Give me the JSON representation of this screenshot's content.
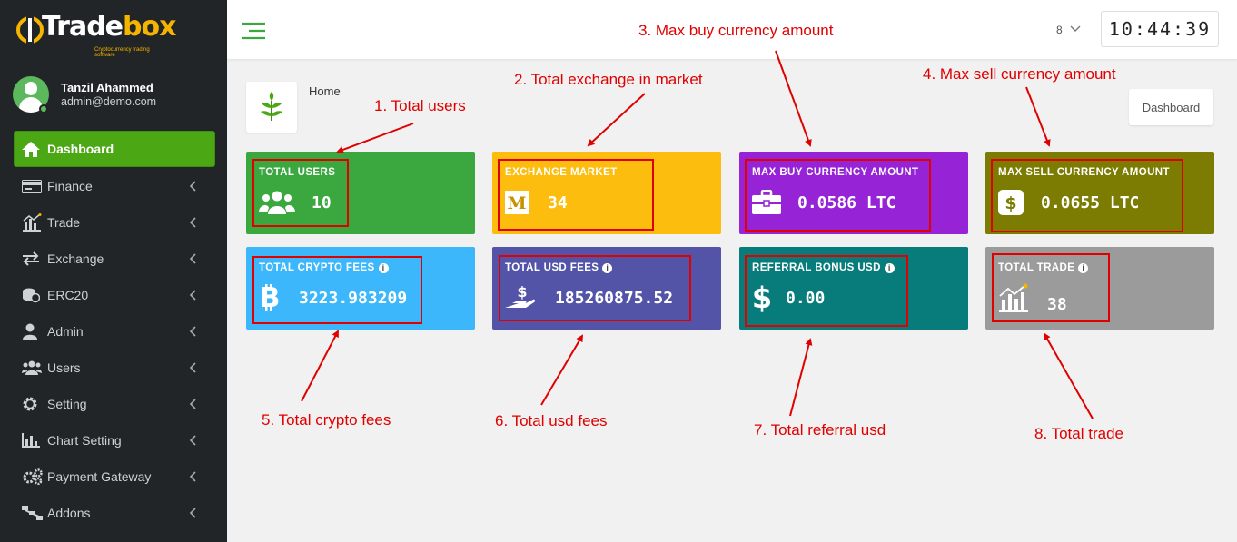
{
  "brand": {
    "name_part1": "Trade",
    "name_part2": "box",
    "tagline": "Cryptocurrency trading software"
  },
  "user": {
    "name": "Tanzil Ahammed",
    "email": "admin@demo.com"
  },
  "sidebar": {
    "items": [
      {
        "label": "Dashboard",
        "icon": "home-icon",
        "active": true
      },
      {
        "label": "Finance",
        "icon": "money-icon"
      },
      {
        "label": "Trade",
        "icon": "chart-icon"
      },
      {
        "label": "Exchange",
        "icon": "exchange-icon"
      },
      {
        "label": "ERC20",
        "icon": "coin-icon"
      },
      {
        "label": "Admin",
        "icon": "user-icon"
      },
      {
        "label": "Users",
        "icon": "users-icon"
      },
      {
        "label": "Setting",
        "icon": "gear-icon"
      },
      {
        "label": "Chart Setting",
        "icon": "bar-chart-icon"
      },
      {
        "label": "Payment Gateway",
        "icon": "gears-icon"
      },
      {
        "label": "Addons",
        "icon": "sitemap-icon"
      }
    ]
  },
  "topbar": {
    "language": "8",
    "clock": "10:44:39"
  },
  "header": {
    "breadcrumb": "Home",
    "dashboard_button": "Dashboard"
  },
  "cards": [
    {
      "label": "TOTAL USERS",
      "value": "10",
      "color": "#3aa73f",
      "icon": "users-icon"
    },
    {
      "label": "EXCHANGE MARKET",
      "value": "34",
      "color": "#fdbd0e",
      "icon": "market-icon"
    },
    {
      "label": "MAX BUY CURRENCY AMOUNT",
      "value": "0.0586 LTC",
      "color": "#9624d6",
      "icon": "briefcase-icon"
    },
    {
      "label": "MAX SELL CURRENCY AMOUNT",
      "value": "0.0655 LTC",
      "color": "#7c7c03",
      "icon": "dollar-box-icon"
    },
    {
      "label": "TOTAL CRYPTO FEES",
      "value": "3223.983209",
      "color": "#3db7fb",
      "icon": "bitcoin-icon",
      "info": "i"
    },
    {
      "label": "TOTAL USD FEES",
      "value": "185260875.52",
      "color": "#5354a7",
      "icon": "hand-dollar-icon",
      "info": "i"
    },
    {
      "label": "REFERRAL BONUS USD",
      "value": "0.00",
      "color": "#087b7b",
      "icon": "dollar-icon",
      "info": "i"
    },
    {
      "label": "TOTAL TRADE",
      "value": "38",
      "color": "#9b9b9b",
      "icon": "trend-chart-icon",
      "info": "i"
    }
  ],
  "annotations": [
    "1. Total users",
    "2. Total exchange in market",
    "3. Max buy currency amount",
    "4. Max sell currency amount",
    "5. Total crypto fees",
    "6. Total usd fees",
    "7. Total referral usd",
    "8. Total trade"
  ]
}
